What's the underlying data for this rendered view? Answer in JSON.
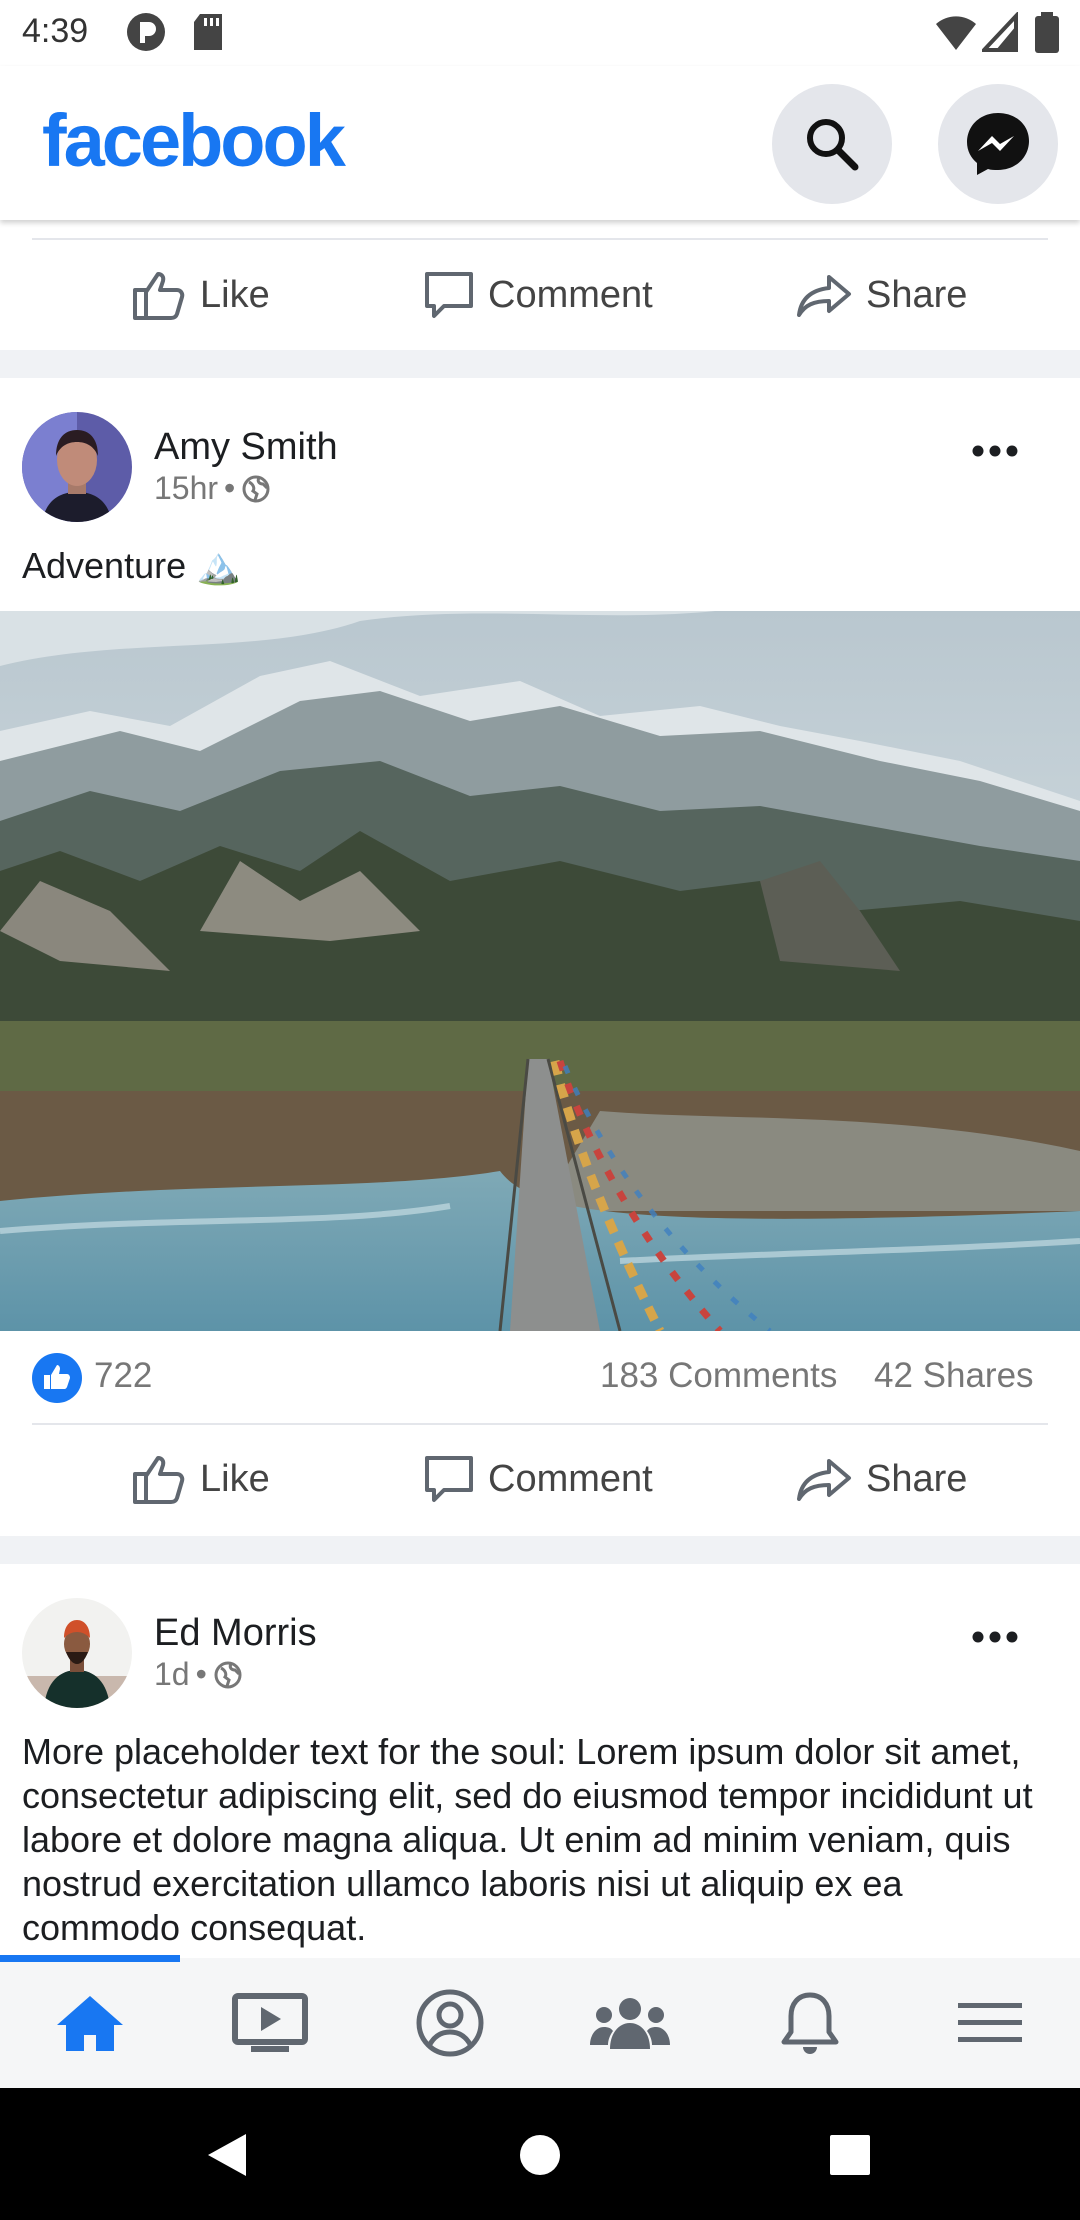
{
  "status_bar": {
    "time": "4:39"
  },
  "header": {
    "logo": "facebook",
    "search_icon": "search-icon",
    "messenger_icon": "messenger-icon"
  },
  "actions": {
    "like": "Like",
    "comment": "Comment",
    "share": "Share"
  },
  "posts": [
    {
      "author": "Amy Smith",
      "time": "15hr",
      "separator": "•",
      "text": "Adventure 🏔️",
      "likes": "722",
      "comments": "183 Comments",
      "shares": "42 Shares"
    },
    {
      "author": "Ed Morris",
      "time": "1d",
      "separator": "•",
      "text": "More placeholder text for the soul: Lorem ipsum dolor sit amet, consectetur adipiscing elit, sed do eiusmod tempor incididunt ut labore et dolore magna aliqua. Ut enim ad minim veniam, quis nostrud exercitation ullamco laboris nisi ut aliquip ex ea commodo consequat."
    }
  ],
  "bottom_nav": [
    "home-icon",
    "watch-icon",
    "profile-icon",
    "groups-icon",
    "notifications-icon",
    "menu-icon"
  ],
  "colors": {
    "brand": "#1877f2",
    "icon": "#606770"
  }
}
